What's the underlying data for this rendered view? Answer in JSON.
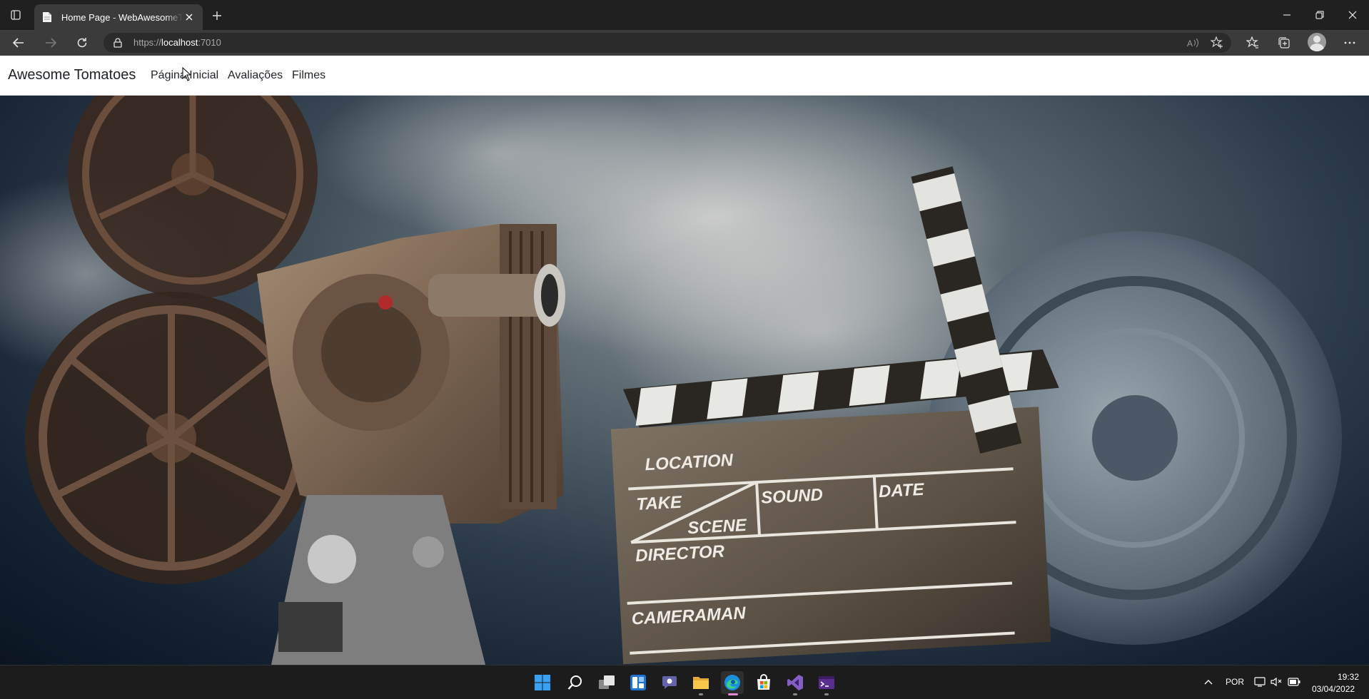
{
  "browser": {
    "tab_title": "Home Page - WebAwesomeTomatoes",
    "url_scheme": "https://",
    "url_host": "localhost",
    "url_port": ":7010"
  },
  "site": {
    "brand": "Awesome Tomatoes",
    "nav": [
      {
        "label": "Página Inicial"
      },
      {
        "label": "Avaliações"
      },
      {
        "label": "Filmes"
      }
    ]
  },
  "hero": {
    "clapper_fields": {
      "location": "LOCATION",
      "take": "TAKE",
      "sound": "SOUND",
      "date": "DATE",
      "scene": "SCENE",
      "director": "DIRECTOR",
      "cameraman": "CAMERAMAN"
    }
  },
  "taskbar": {
    "apps": [
      "windows-start",
      "search",
      "task-view",
      "widgets",
      "teams-chat",
      "file-explorer",
      "edge",
      "microsoft-store",
      "visual-studio",
      "terminal"
    ],
    "language": "POR",
    "time": "19:32",
    "date": "03/04/2022"
  },
  "colors": {
    "browser_dark": "#202020",
    "toolbar": "#3b3b3b",
    "taskbar": "#1c1c1c",
    "edge_accent": "#e38bd4",
    "start_blue": "#3aa0f3"
  }
}
